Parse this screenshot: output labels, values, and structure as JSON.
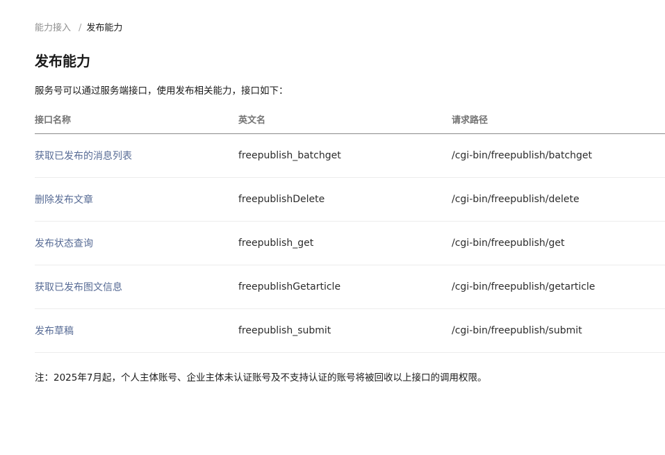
{
  "breadcrumb": {
    "parent": "能力接入",
    "separator": "/",
    "current": "发布能力"
  },
  "page_title": "发布能力",
  "intro": "服务号可以通过服务端接口，使用发布相关能力，接口如下：",
  "table": {
    "headers": [
      "接口名称",
      "英文名",
      "请求路径"
    ],
    "rows": [
      {
        "name": "获取已发布的消息列表",
        "english": "freepublish_batchget",
        "path": "/cgi-bin/freepublish/batchget"
      },
      {
        "name": "删除发布文章",
        "english": "freepublishDelete",
        "path": "/cgi-bin/freepublish/delete"
      },
      {
        "name": "发布状态查询",
        "english": "freepublish_get",
        "path": "/cgi-bin/freepublish/get"
      },
      {
        "name": "获取已发布图文信息",
        "english": "freepublishGetarticle",
        "path": "/cgi-bin/freepublish/getarticle"
      },
      {
        "name": "发布草稿",
        "english": "freepublish_submit",
        "path": "/cgi-bin/freepublish/submit"
      }
    ]
  },
  "note": "注：2025年7月起，个人主体账号、企业主体未认证账号及不支持认证的账号将被回收以上接口的调用权限。",
  "colors": {
    "link": "#576b95",
    "header_text": "#737373",
    "breadcrumb_parent": "#8f8f8f",
    "row_divider": "#ececec",
    "header_divider": "#8a8a8a"
  }
}
